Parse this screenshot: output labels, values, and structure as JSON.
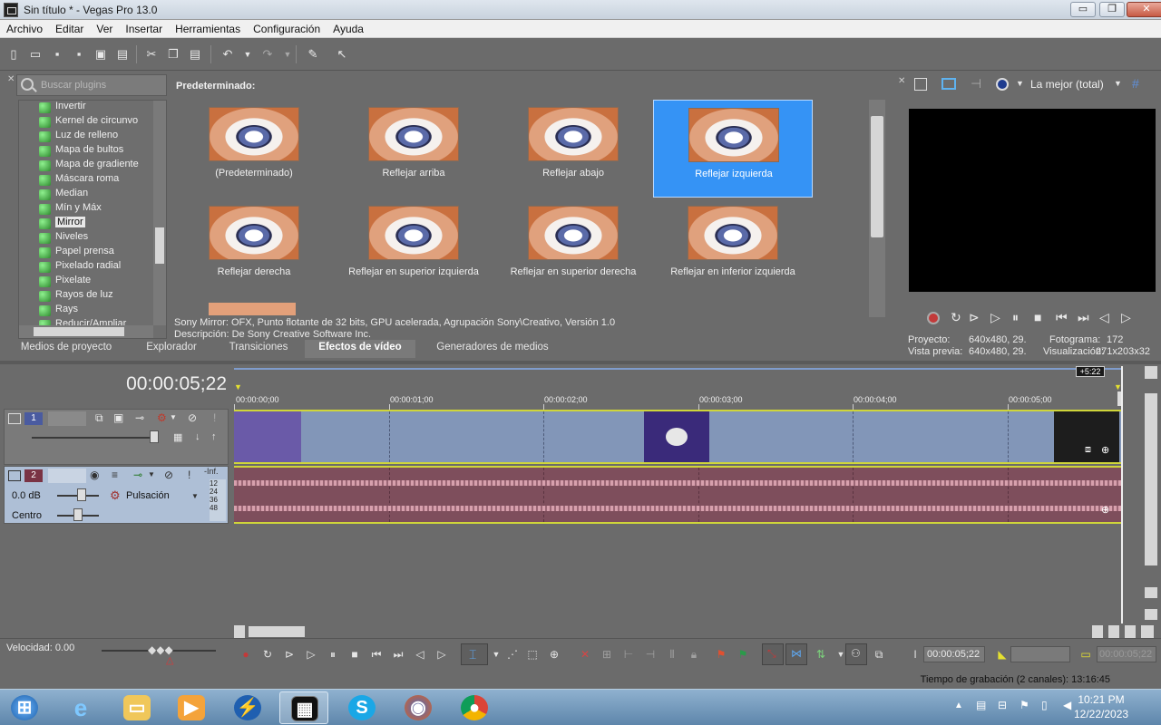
{
  "window": {
    "title": "Sin título * - Vegas Pro 13.0",
    "minimize": "▭",
    "maximize": "❐",
    "close": "✕"
  },
  "menu": [
    "Archivo",
    "Editar",
    "Ver",
    "Insertar",
    "Herramientas",
    "Configuración",
    "Ayuda"
  ],
  "plugins": {
    "search_placeholder": "Buscar plugins",
    "tree": [
      "Invertir",
      "Kernel de circunvo",
      "Luz de relleno",
      "Mapa de bultos",
      "Mapa de gradiente",
      "Máscara roma",
      "Median",
      "Mín y Máx",
      "Mirror",
      "Niveles",
      "Papel prensa",
      "Pixelado radial",
      "Pixelate",
      "Rayos de luz",
      "Rays",
      "Reducir/Ampliar"
    ],
    "selected_tree_item": "Mirror",
    "presets_header": "Predeterminado:",
    "presets": [
      "(Predeterminado)",
      "Reflejar arriba",
      "Reflejar abajo",
      "Reflejar izquierda",
      "Reflejar derecha",
      "Reflejar en superior izquierda",
      "Reflejar en superior derecha",
      "Reflejar en inferior izquierda"
    ],
    "selected_preset": "Reflejar izquierda",
    "description_line1": "Sony Mirror: OFX, Punto flotante de 32 bits, GPU acelerada, Agrupación Sony\\Creativo, Versión 1.0",
    "description_line2": "Descripción: De Sony Creative Software Inc."
  },
  "tabs": [
    "Medios de proyecto",
    "Explorador",
    "Transiciones",
    "Efectos de vídeo",
    "Generadores de medios"
  ],
  "active_tab": "Efectos de vídeo",
  "preview": {
    "quality": "La mejor (total)",
    "proyecto_label": "Proyecto:",
    "proyecto_value": "640x480, 29.",
    "vista_label": "Vista previa:",
    "vista_value": "640x480, 29.",
    "fotograma_label": "Fotograma:",
    "fotograma_value": "172",
    "visualizacion_label": "Visualización:",
    "visualizacion_value": "271x203x32"
  },
  "timeline": {
    "timecode": "00:00:05;22",
    "marker_label": "+5:22",
    "ruler": [
      "00:00:00;00",
      "00:00:01;00",
      "00:00:02;00",
      "00:00:03;00",
      "00:00:04;00",
      "00:00:05;00"
    ],
    "track1_number": "1",
    "track2_number": "2",
    "track2_volume": "0.0 dB",
    "track2_pan": "Centro",
    "track2_fx": "Pulsación",
    "meter_top": "-Inf.",
    "meter_values": [
      "12",
      "24",
      "36",
      "48"
    ]
  },
  "transport": {
    "velocity": "Velocidad: 0.00",
    "cursor_time": "00:00:05;22",
    "end_time": "00:00:05;22"
  },
  "status": {
    "recording_time": "Tiempo de grabación (2 canales): 13:16:45"
  },
  "taskbar": {
    "time": "10:21 PM",
    "date": "12/22/2023"
  },
  "colors": {
    "selected_preset": "#3593f5",
    "video_track": "#8296b8",
    "audio_track": "#7e4e5c",
    "envelope": "#cfd53a"
  }
}
